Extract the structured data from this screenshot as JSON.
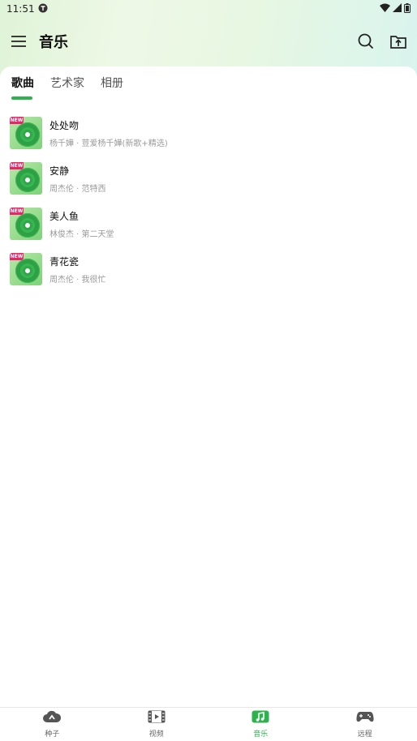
{
  "status_bar": {
    "time": "11:51"
  },
  "app_bar": {
    "title": "音乐"
  },
  "tabs": [
    {
      "label": "歌曲",
      "active": true
    },
    {
      "label": "艺术家",
      "active": false
    },
    {
      "label": "相册",
      "active": false
    }
  ],
  "songs": [
    {
      "title": "处处吻",
      "subtitle": "杨千嬅 · 荳爱杨千嬅(新歌+精选)",
      "badge": "NEW"
    },
    {
      "title": "安静",
      "subtitle": "周杰伦 · 范特西",
      "badge": "NEW"
    },
    {
      "title": "美人鱼",
      "subtitle": "林俊杰 · 第二天堂",
      "badge": "NEW"
    },
    {
      "title": "青花瓷",
      "subtitle": "周杰伦 · 我很忙",
      "badge": "NEW"
    }
  ],
  "bottom_nav": [
    {
      "label": "种子",
      "icon": "seed-cloud-icon",
      "active": false
    },
    {
      "label": "视频",
      "icon": "film-icon",
      "active": false
    },
    {
      "label": "音乐",
      "icon": "music-icon",
      "active": true
    },
    {
      "label": "远程",
      "icon": "gamepad-icon",
      "active": false
    }
  ],
  "colors": {
    "accent": "#2db24d",
    "badge": "#e8246a"
  }
}
